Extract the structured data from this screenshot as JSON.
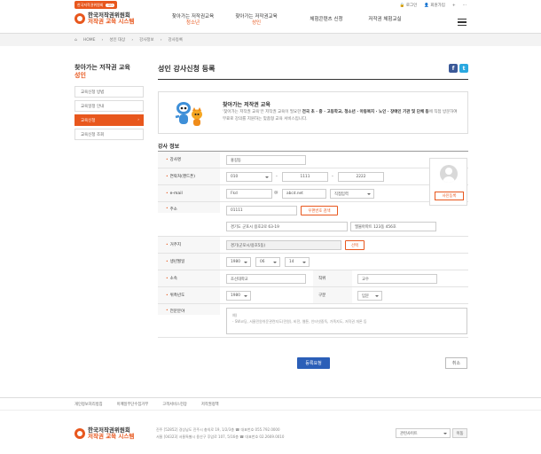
{
  "topbar": {
    "badge": "한국저작권위원회",
    "badge_tag": "GO",
    "login": "로그인",
    "signup": "회원가입",
    "plus": "+",
    "more": "···"
  },
  "header": {
    "logo_line1": "한국저작권위원회",
    "logo_line2": "저작권 교육 시스템",
    "nav": [
      {
        "label": "찾아가는 저작권교육",
        "sub": "청소년"
      },
      {
        "label": "찾아가는 저작권교육",
        "sub": "성인"
      },
      {
        "label": "체험콘텐츠 신청",
        "sub": ""
      },
      {
        "label": "저작권 체험교실",
        "sub": ""
      }
    ]
  },
  "breadcrumb": [
    "HOME",
    "성인 대상",
    "강사정보",
    "강사등록"
  ],
  "sidebar": {
    "title": "찾아가는 저작권 교육",
    "subtitle": "성인",
    "items": [
      {
        "label": "교육신청 방법"
      },
      {
        "label": "교육일정 안내"
      },
      {
        "label": "교육신청"
      },
      {
        "label": "교육신청 조회"
      }
    ]
  },
  "main": {
    "title": "성인 강사신청 등록",
    "sns": {
      "facebook": "f",
      "twitter": "t"
    },
    "intro_title": "찾아가는 저작권 교육",
    "intro_text_1": "'찾아가는 저작권 교육'은 저작권 교육이 필요한 ",
    "intro_bold_1": "전국 초 · 중 · 고등학교, 청소년 · 아동복지 · 노인 · 장애인 기관 및 단체 등",
    "intro_text_2": "에 직접 방문하여 무료로 강의를 지원하는 맞춤형 교육 서비스입니다.",
    "section_title": "강사 정보"
  },
  "form": {
    "name": {
      "label": "강사명",
      "value": "홍길동"
    },
    "phone": {
      "label": "연락처(핸드폰)",
      "p1": "010",
      "p2": "1111",
      "p3": "2222"
    },
    "email": {
      "label": "e-mail",
      "id": "Fkd",
      "at": "@",
      "domain": "abcd.net",
      "select": "직접입력"
    },
    "address": {
      "label": "주소",
      "zip": "01111",
      "search_btn": "우편번호 검색",
      "addr1": "경기도 군포시 용호2로 63-19",
      "addr2": "엘물아파트 123동 456호"
    },
    "residence": {
      "label": "거주지",
      "value": "경기(군포시/용호5동)",
      "select_btn": "선택"
    },
    "birth": {
      "label": "생년월일",
      "year": "1980",
      "month": "06",
      "day": "14"
    },
    "org": {
      "label": "소속",
      "value": "조선대학교",
      "pos_label": "직위",
      "pos_value": "교수"
    },
    "year": {
      "label": "위촉년도",
      "value": "1980",
      "type_label": "구분",
      "type_value": "입문"
    },
    "field": {
      "label": "전문분야",
      "ph1": "예)",
      "ph2": "- SW코딩, 서울민원쉬운관련지도(민원), 비전, 웹툰, 인터넷중독, 가족지도, 저작권 개론 등"
    },
    "photo_btn": "사진등록"
  },
  "buttons": {
    "submit": "등록요청",
    "cancel": "취소"
  },
  "footer": {
    "links": [
      "개인정보처리방침",
      "이메일무단수집거부",
      "고객서비스헌장",
      "저작권정책"
    ],
    "logo_line1": "한국저작권위원회",
    "logo_line2": "저작권 교육 시스템",
    "addr1": "진주 [52852] 경상남도 진주시 충의로 19, 1/2/3층 ☎ 대표번호 055.792.0000",
    "addr2": "서울 [04323] 서울특별시 용산구 후암로 107, 5/16층 ☎ 대표번호 02.2669.0010",
    "related": "관련사이트",
    "go": "이동"
  }
}
